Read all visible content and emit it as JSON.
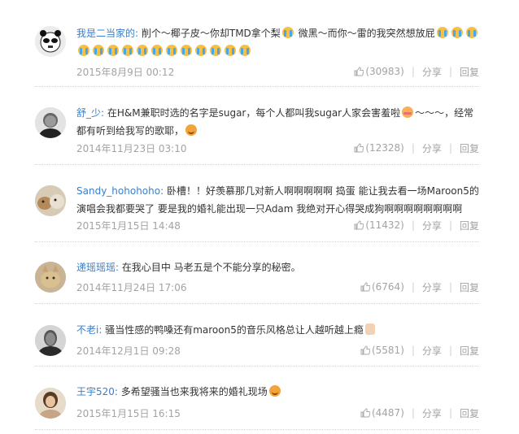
{
  "comments": [
    {
      "user": "我是二当家的:",
      "segments": [
        {
          "t": "text",
          "v": " 削个～椰子皮～你却TMD拿个梨"
        },
        {
          "t": "emoji",
          "v": "cry"
        },
        {
          "t": "text",
          "v": " 微黑～而你～雷的我突然想放屁"
        },
        {
          "t": "emoji",
          "v": "cry"
        },
        {
          "t": "emoji",
          "v": "cry"
        },
        {
          "t": "emoji",
          "v": "cry"
        },
        {
          "t": "emoji",
          "v": "cry"
        },
        {
          "t": "emoji",
          "v": "cry"
        },
        {
          "t": "emoji",
          "v": "cry"
        },
        {
          "t": "emoji",
          "v": "cry"
        },
        {
          "t": "emoji",
          "v": "cry"
        },
        {
          "t": "emoji",
          "v": "cry"
        },
        {
          "t": "emoji",
          "v": "cry"
        },
        {
          "t": "emoji",
          "v": "cry"
        },
        {
          "t": "emoji",
          "v": "cry"
        },
        {
          "t": "emoji",
          "v": "cry"
        },
        {
          "t": "emoji",
          "v": "cry"
        },
        {
          "t": "emoji",
          "v": "cry"
        }
      ],
      "time": "2015年8月9日 00:12",
      "likes": "(30983)",
      "share": "分享",
      "reply": "回复",
      "avatar": "panda"
    },
    {
      "user": "舒_少:",
      "segments": [
        {
          "t": "text",
          "v": " 在H&M兼职时选的名字是sugar，每个人都叫我sugar人家会害羞啦"
        },
        {
          "t": "emoji",
          "v": "blush"
        },
        {
          "t": "text",
          "v": "～～～，经常都有听到给我写的歌耶，"
        },
        {
          "t": "emoji",
          "v": "smile"
        }
      ],
      "time": "2014年11月23日 03:10",
      "likes": "(12328)",
      "share": "分享",
      "reply": "回复",
      "avatar": "man"
    },
    {
      "user": "Sandy_hohohoho:",
      "segments": [
        {
          "t": "text",
          "v": " 卧槽！！好羡慕那几对新人啊啊啊啊啊 捣蛋 能让我去看一场Maroon5的演唱会我都要哭了 要是我的婚礼能出现一只Adam 我绝对开心得哭成狗啊啊啊啊啊啊啊啊"
        }
      ],
      "time": "2015年1月15日 14:48",
      "likes": "(11432)",
      "share": "分享",
      "reply": "回复",
      "avatar": "dog"
    },
    {
      "user": "递瑶瑶瑶:",
      "segments": [
        {
          "t": "text",
          "v": " 在我心目中 马老五是个不能分享的秘密。"
        }
      ],
      "time": "2014年11月24日 17:06",
      "likes": "(6764)",
      "share": "分享",
      "reply": "回复",
      "avatar": "cat"
    },
    {
      "user": "不老i:",
      "segments": [
        {
          "t": "text",
          "v": " 骚当性感的鸭嗓还有maroon5的音乐风格总让人越听越上瘾"
        },
        {
          "t": "emoji",
          "v": "thumb"
        }
      ],
      "time": "2014年12月1日 09:28",
      "likes": "(5581)",
      "share": "分享",
      "reply": "回复",
      "avatar": "bw"
    },
    {
      "user": "王宇520:",
      "segments": [
        {
          "t": "text",
          "v": " 多希望骚当也来我将来的婚礼现场"
        },
        {
          "t": "emoji",
          "v": "smile"
        }
      ],
      "time": "2015年1月15日 16:15",
      "likes": "(4487)",
      "share": "分享",
      "reply": "回复",
      "avatar": "woman"
    }
  ]
}
